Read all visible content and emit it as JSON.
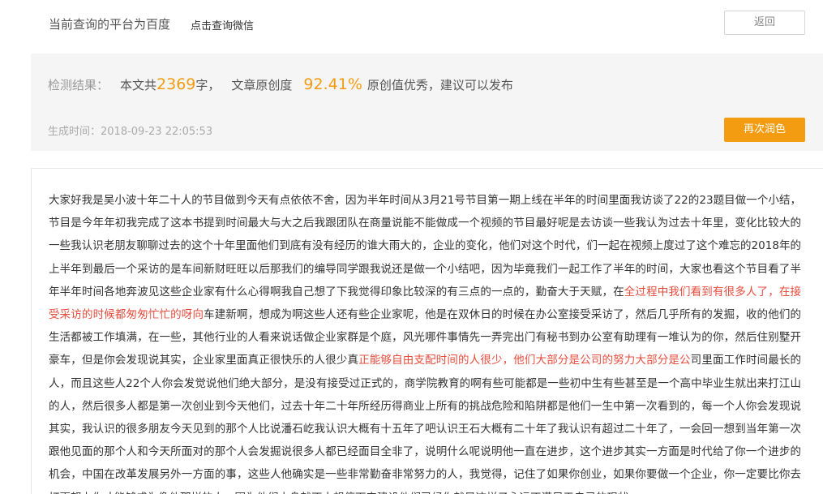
{
  "header": {
    "platform_text": "当前查询的平台为百度",
    "wechat_link": "点击查询微信",
    "back_button": "返回"
  },
  "result": {
    "label": "检测结果：",
    "word_count_prefix": "本文共",
    "word_count": "2369",
    "word_count_suffix": "字，",
    "originality_label": "文章原创度",
    "originality_value": "92.41%",
    "verdict": "原创值优秀，建议可以发布",
    "time_label": "生成时间：",
    "time_value": "2018-09-23 22:05:53",
    "retouch_button": "再次润色"
  },
  "article": {
    "segments": [
      {
        "text": "大家好我是吴小波十年二十人的节目做到今天有点依依不舍，因为半年时间从3月21号节目第一期上线在半年的时间里面我访谈了22的23题目做一个小结，节目是今年年初我完成了这本书提到时间最大与大之后我跟团队在商量说能不能做成一个视频的节目最好呢是去访谈一些我认为过去十年里，变化比较大的一些我认识老朋友聊聊过去的这个十年里面他们到底有没有经历的谁大雨大的，企业的变化，他们对这个时代，们一起在视频上度过了这个难忘的2018年的上半年到最后一个采访的是车间新财旺旺以后那我们的编导同学跟我说还是做一个小结吧，因为毕竟我们一起工作了半年的时间，大家也看这个节目看了半年半年时间各地奔波见这些企业家有什么心得啊我自己想了下我觉得印象比较深的有三点的一点的，勤奋大于天赋，在",
        "highlight": false
      },
      {
        "text": "全过程中我们看到有很多人了，在接受采访的时候都匆匆忙忙的呀向",
        "highlight": true
      },
      {
        "text": "车建新啊，想成为啊这些人还有些企业家呢，他是在双休日的时候在办公室接受采访了，然后几乎所有的发掘，收的他们的生活都被工作填满，在一些，其他行业的人看来说话做企业家群是个庭，风光哪件事情先一弄完出门有秘书到办公室有助理有一堆认为的你，然后住别墅开豪车，但是你会发现说其实，企业家里面真正很快乐的人很少真",
        "highlight": false
      },
      {
        "text": "正能够自由支配时间的人很少，他们大部分是公司的努力大部分是公",
        "highlight": true
      },
      {
        "text": "司里面工作时间最长的人，而且这些人22个人你会发觉说他们绝大部分，是没有接受过正式的，商学院教育的啊有些可能都是一些初中生有些甚至是一个高中毕业生就出来打江山的人，然后很多人都是第一次创业到今天他们，过去十年二十年所经历得商业上所有的挑战危险和陷阱都是他们一生中第一次看到的，每一个人你会发现说其实，我认识的很多朋友今天见到的那个人比说潘石屹我认识大概有十五年了吧认识王石大概有二十年了我认识有超过二十年了，一会回一想到当年第一次跟他见面的那个人和今天所面对的那个人会发掘说很多人都已经面目全非了，说明什么呢说明他一直在进步，这个进步其实一方面是时代给了你一个进步的机会，中国在改革发展另外一方面的事，这些人他确实是一些非常勤奋非常努力的人，我觉得，记住了如果你创业，如果你要做一个企业，你一定要比你去打更努力你才能够成为像他那样的人，因为他们本身就不太想停下来建设他们已经你就是这样子永远不满足于自己的现状",
        "highlight": false
      }
    ]
  }
}
